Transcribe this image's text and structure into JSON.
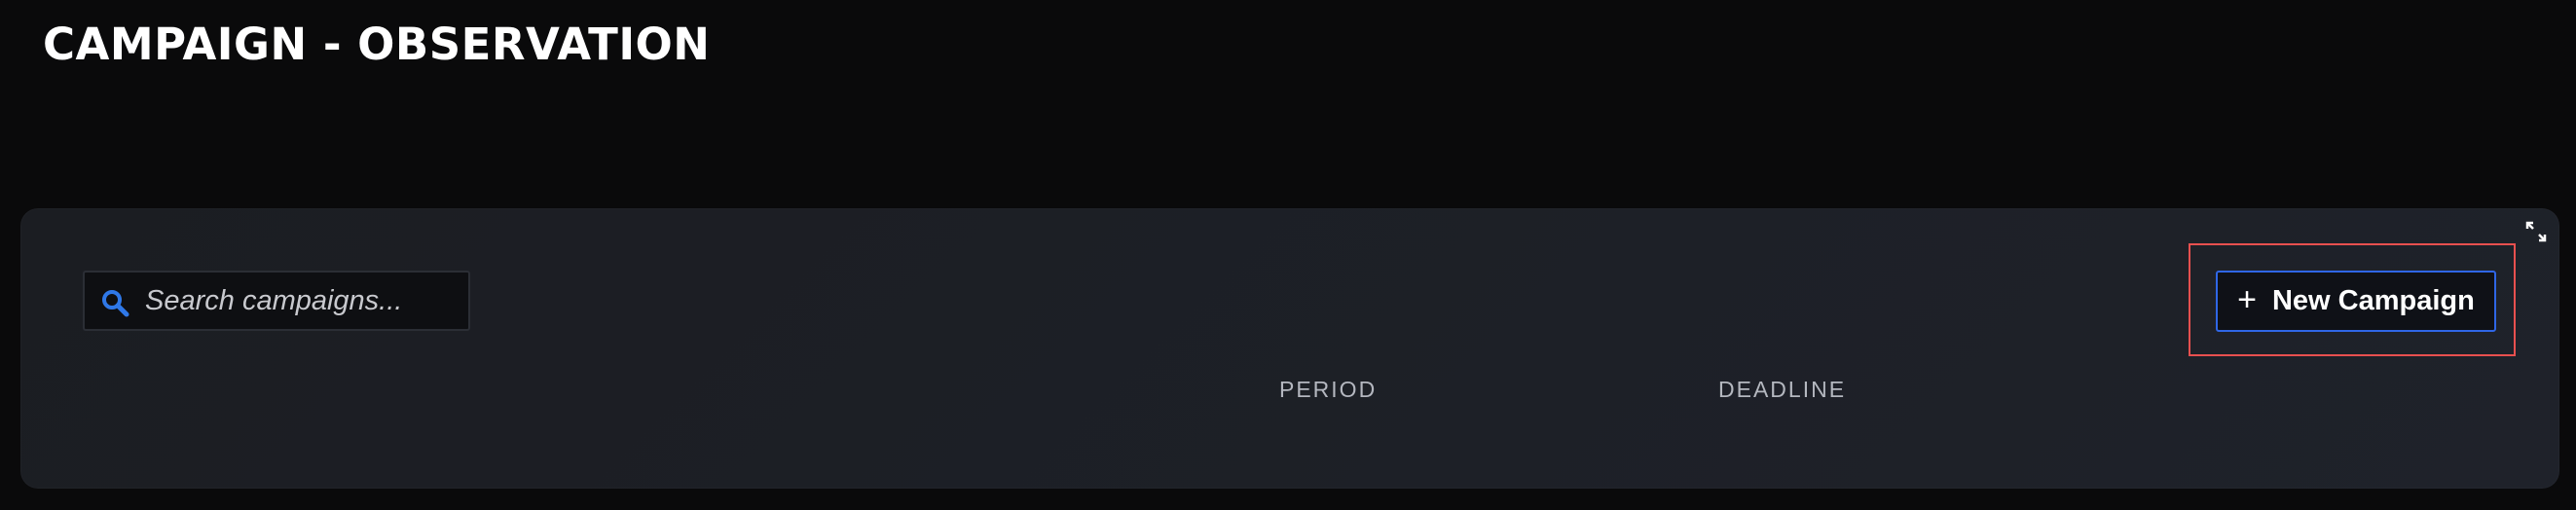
{
  "header": {
    "title": "CAMPAIGN - OBSERVATION"
  },
  "search": {
    "placeholder": "Search campaigns...",
    "value": "",
    "icon": "search-icon"
  },
  "toolbar": {
    "new_campaign_label": "New Campaign",
    "new_campaign_icon": "plus-icon",
    "expand_icon": "expand-icon"
  },
  "table": {
    "columns": [
      "PERIOD",
      "DEADLINE"
    ]
  },
  "colors": {
    "background": "#0a0a0b",
    "panel": "#1d2027",
    "accent": "#2f66e6",
    "highlight_outline": "#e8504f",
    "search_icon": "#2f78e8"
  }
}
